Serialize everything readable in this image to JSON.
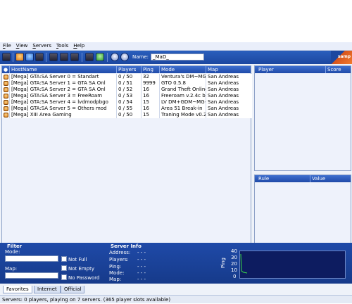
{
  "menu": [
    "File",
    "View",
    "Servers",
    "Tools",
    "Help"
  ],
  "toolbar": {
    "name_label": "Name:",
    "name_value": "_MaD_",
    "logo_text": "samp"
  },
  "columns": {
    "hostname": "HostName",
    "players": "Players",
    "ping": "Ping",
    "mode": "Mode",
    "map": "Map"
  },
  "servers": [
    {
      "host": "[Mega] GTA:SA Server 0 = Standart",
      "players": "0 / 50",
      "ping": "32",
      "mode": "Ventura's DM~MG",
      "map": "San Andreas"
    },
    {
      "host": "[Mega] GTA:SA Server 1 = GTA SA Onl",
      "players": "0 / 51",
      "ping": "9999",
      "mode": "GTO 0.5.8",
      "map": "San Andreas"
    },
    {
      "host": "[Mega] GTA:SA Server 2 = GTA SA Onl",
      "players": "0 / 52",
      "ping": "16",
      "mode": "Grand Theft Online",
      "map": "San Andreas"
    },
    {
      "host": "[Mega] GTA:SA Server 3 = FreeRoam",
      "players": "0 / 53",
      "ping": "16",
      "mode": "Freeroam v.2.4c b",
      "map": "San Andreas"
    },
    {
      "host": "[Mega] GTA:SA Server 4 = lvdmodpbgo",
      "players": "0 / 54",
      "ping": "15",
      "mode": "LV DM+GDM~MG+",
      "map": "San Andreas"
    },
    {
      "host": "[Mega] GTA:SA Server 5 = Others mod",
      "players": "0 / 55",
      "ping": "16",
      "mode": "Area 51 Break-in",
      "map": "San Andreas"
    },
    {
      "host": "[Mega] XIII Area Gaming",
      "players": "0 / 50",
      "ping": "15",
      "mode": "Traning Mode v0.2",
      "map": "San Andreas"
    }
  ],
  "player_panel": {
    "col1": "Player",
    "col2": "Score"
  },
  "rules_panel": {
    "col1": "Rule",
    "col2": "Value"
  },
  "filter": {
    "title": "Filter",
    "mode_label": "Mode:",
    "map_label": "Map:",
    "not_full": "Not Full",
    "not_empty": "Not Empty",
    "no_password": "No Password"
  },
  "server_info": {
    "title": "Server Info",
    "address_label": "Address:",
    "address_value": "- - -",
    "players_label": "Players:",
    "players_value": "- - -",
    "ping_label": "Ping:",
    "ping_value": "- - -",
    "mode_label": "Mode:",
    "mode_value": "- - -",
    "map_label": "Map:",
    "map_value": "- - -"
  },
  "ping_graph": {
    "axis_label": "Ping",
    "ticks": [
      "40",
      "30",
      "20",
      "10",
      "0"
    ]
  },
  "tabs": [
    "Favorites",
    "Internet",
    "Official"
  ],
  "status": "Servers: 0 players, playing on 7 servers. (365 player slots available)"
}
